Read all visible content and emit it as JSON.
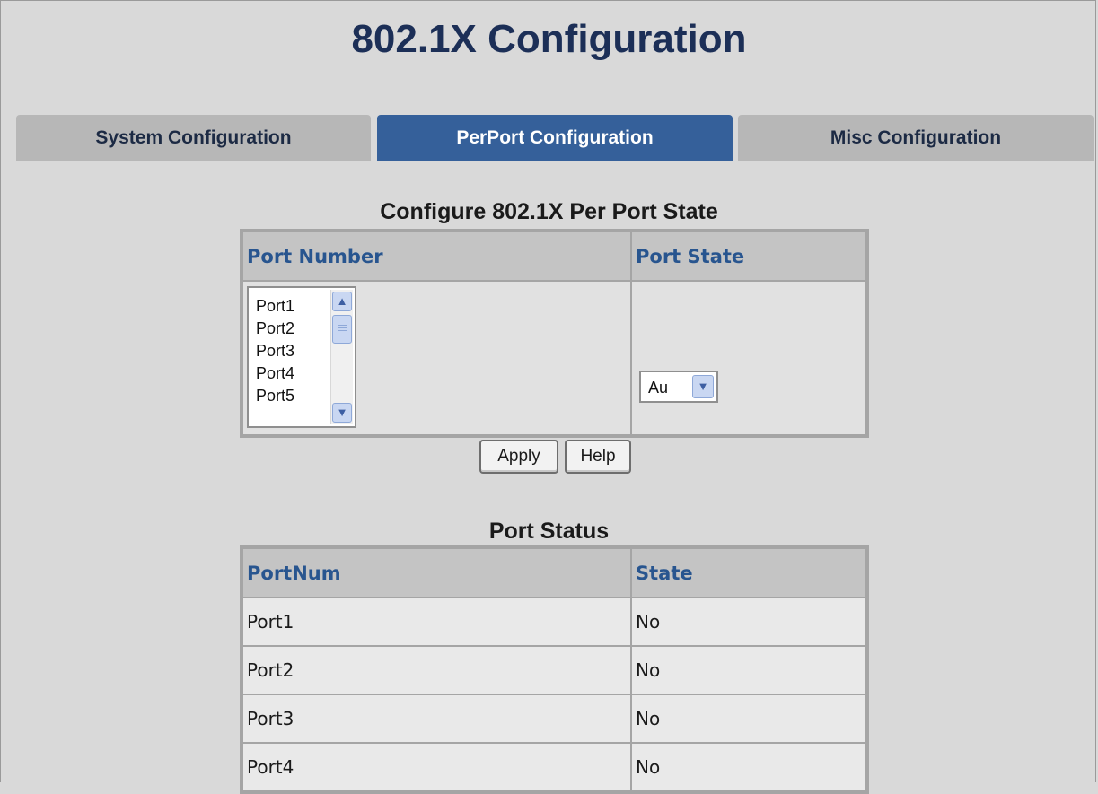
{
  "page": {
    "title": "802.1X Configuration"
  },
  "tabs": [
    {
      "label": "System Configuration",
      "active": false
    },
    {
      "label": "PerPort Configuration",
      "active": true
    },
    {
      "label": "Misc Configuration",
      "active": false
    }
  ],
  "config": {
    "title": "Configure 802.1X Per Port State",
    "col_port_number": "Port Number",
    "col_port_state": "Port State",
    "port_list": [
      "Port1",
      "Port2",
      "Port3",
      "Port4",
      "Port5"
    ],
    "port_state_value": "Au",
    "apply_label": "Apply",
    "help_label": "Help"
  },
  "status": {
    "title": "Port Status",
    "col_portnum": "PortNum",
    "col_state": "State",
    "rows": [
      {
        "port": "Port1",
        "state": "No"
      },
      {
        "port": "Port2",
        "state": "No"
      },
      {
        "port": "Port3",
        "state": "No"
      },
      {
        "port": "Port4",
        "state": "No"
      }
    ]
  },
  "colors": {
    "title": "#1c2f57",
    "active_tab": "#35609a",
    "inactive_tab": "#b7b7b7",
    "header_text": "#28558f",
    "background": "#d9d9d9"
  },
  "icons": {
    "scroll_up": "chevron-up-icon",
    "scroll_down": "chevron-down-icon",
    "dropdown": "chevron-down-icon"
  }
}
